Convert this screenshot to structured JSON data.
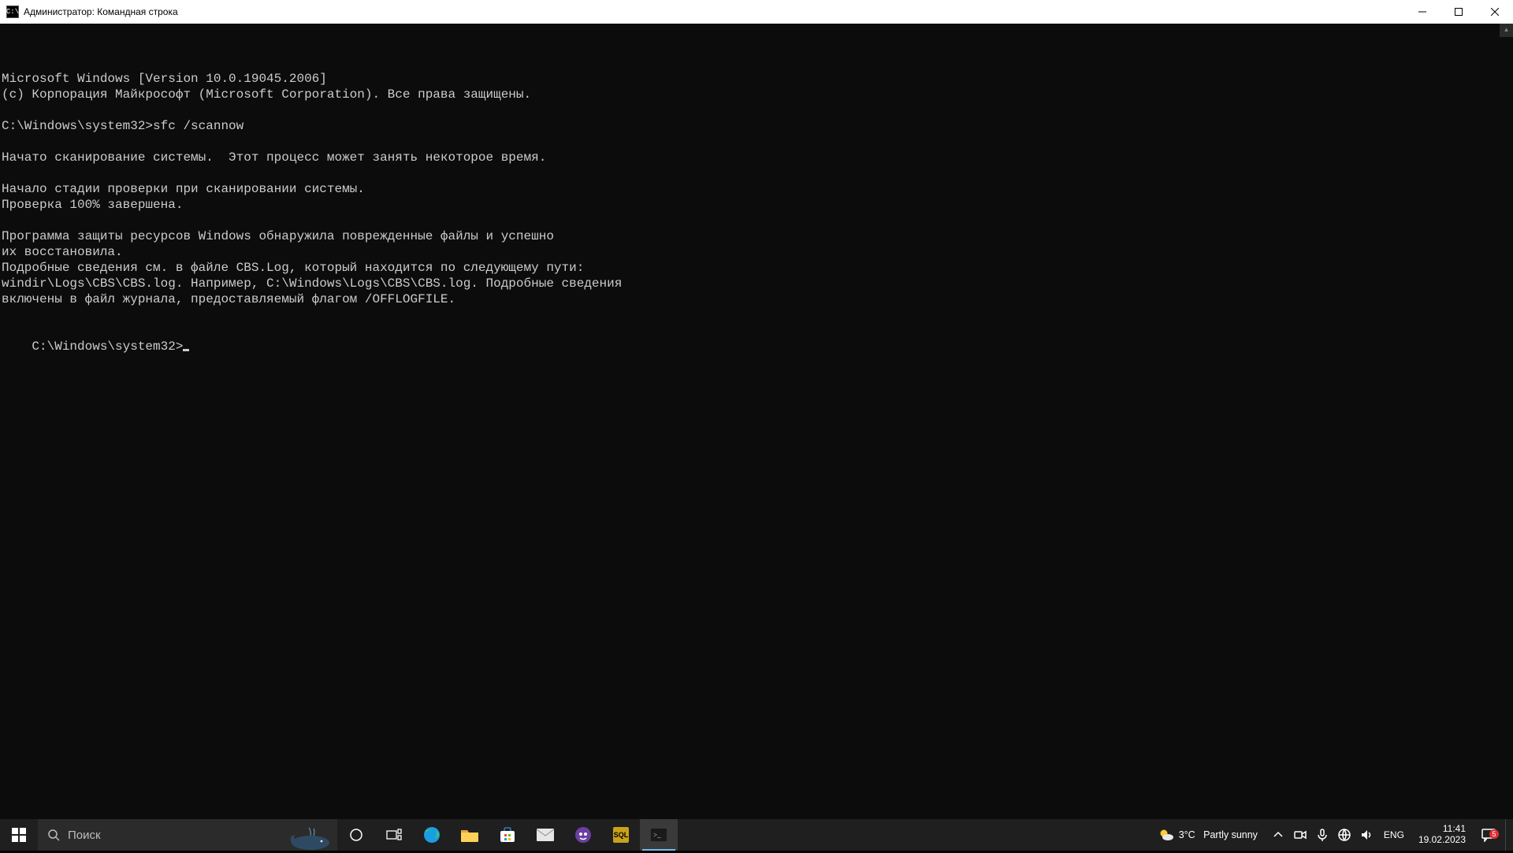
{
  "window": {
    "title": "Администратор: Командная строка",
    "icon_label": "C:\\"
  },
  "terminal": {
    "lines": [
      "Microsoft Windows [Version 10.0.19045.2006]",
      "(c) Корпорация Майкрософт (Microsoft Corporation). Все права защищены.",
      "",
      "C:\\Windows\\system32>sfc /scannow",
      "",
      "Начато сканирование системы.  Этот процесс может занять некоторое время.",
      "",
      "Начало стадии проверки при сканировании системы.",
      "Проверка 100% завершена.",
      "",
      "Программа защиты ресурсов Windows обнаружила поврежденные файлы и успешно",
      "их восстановила.",
      "Подробные сведения см. в файле CBS.Log, который находится по следующему пути:",
      "windir\\Logs\\CBS\\CBS.log. Например, C:\\Windows\\Logs\\CBS\\CBS.log. Подробные сведения",
      "включены в файл журнала, предоставляемый флагом /OFFLOGFILE.",
      ""
    ],
    "prompt": "C:\\Windows\\system32>"
  },
  "taskbar": {
    "search_placeholder": "Поиск",
    "weather": {
      "temp": "3°C",
      "desc": "Partly sunny"
    },
    "lang": "ENG",
    "time": "11:41",
    "date": "19.02.2023",
    "action_badge": "5"
  }
}
